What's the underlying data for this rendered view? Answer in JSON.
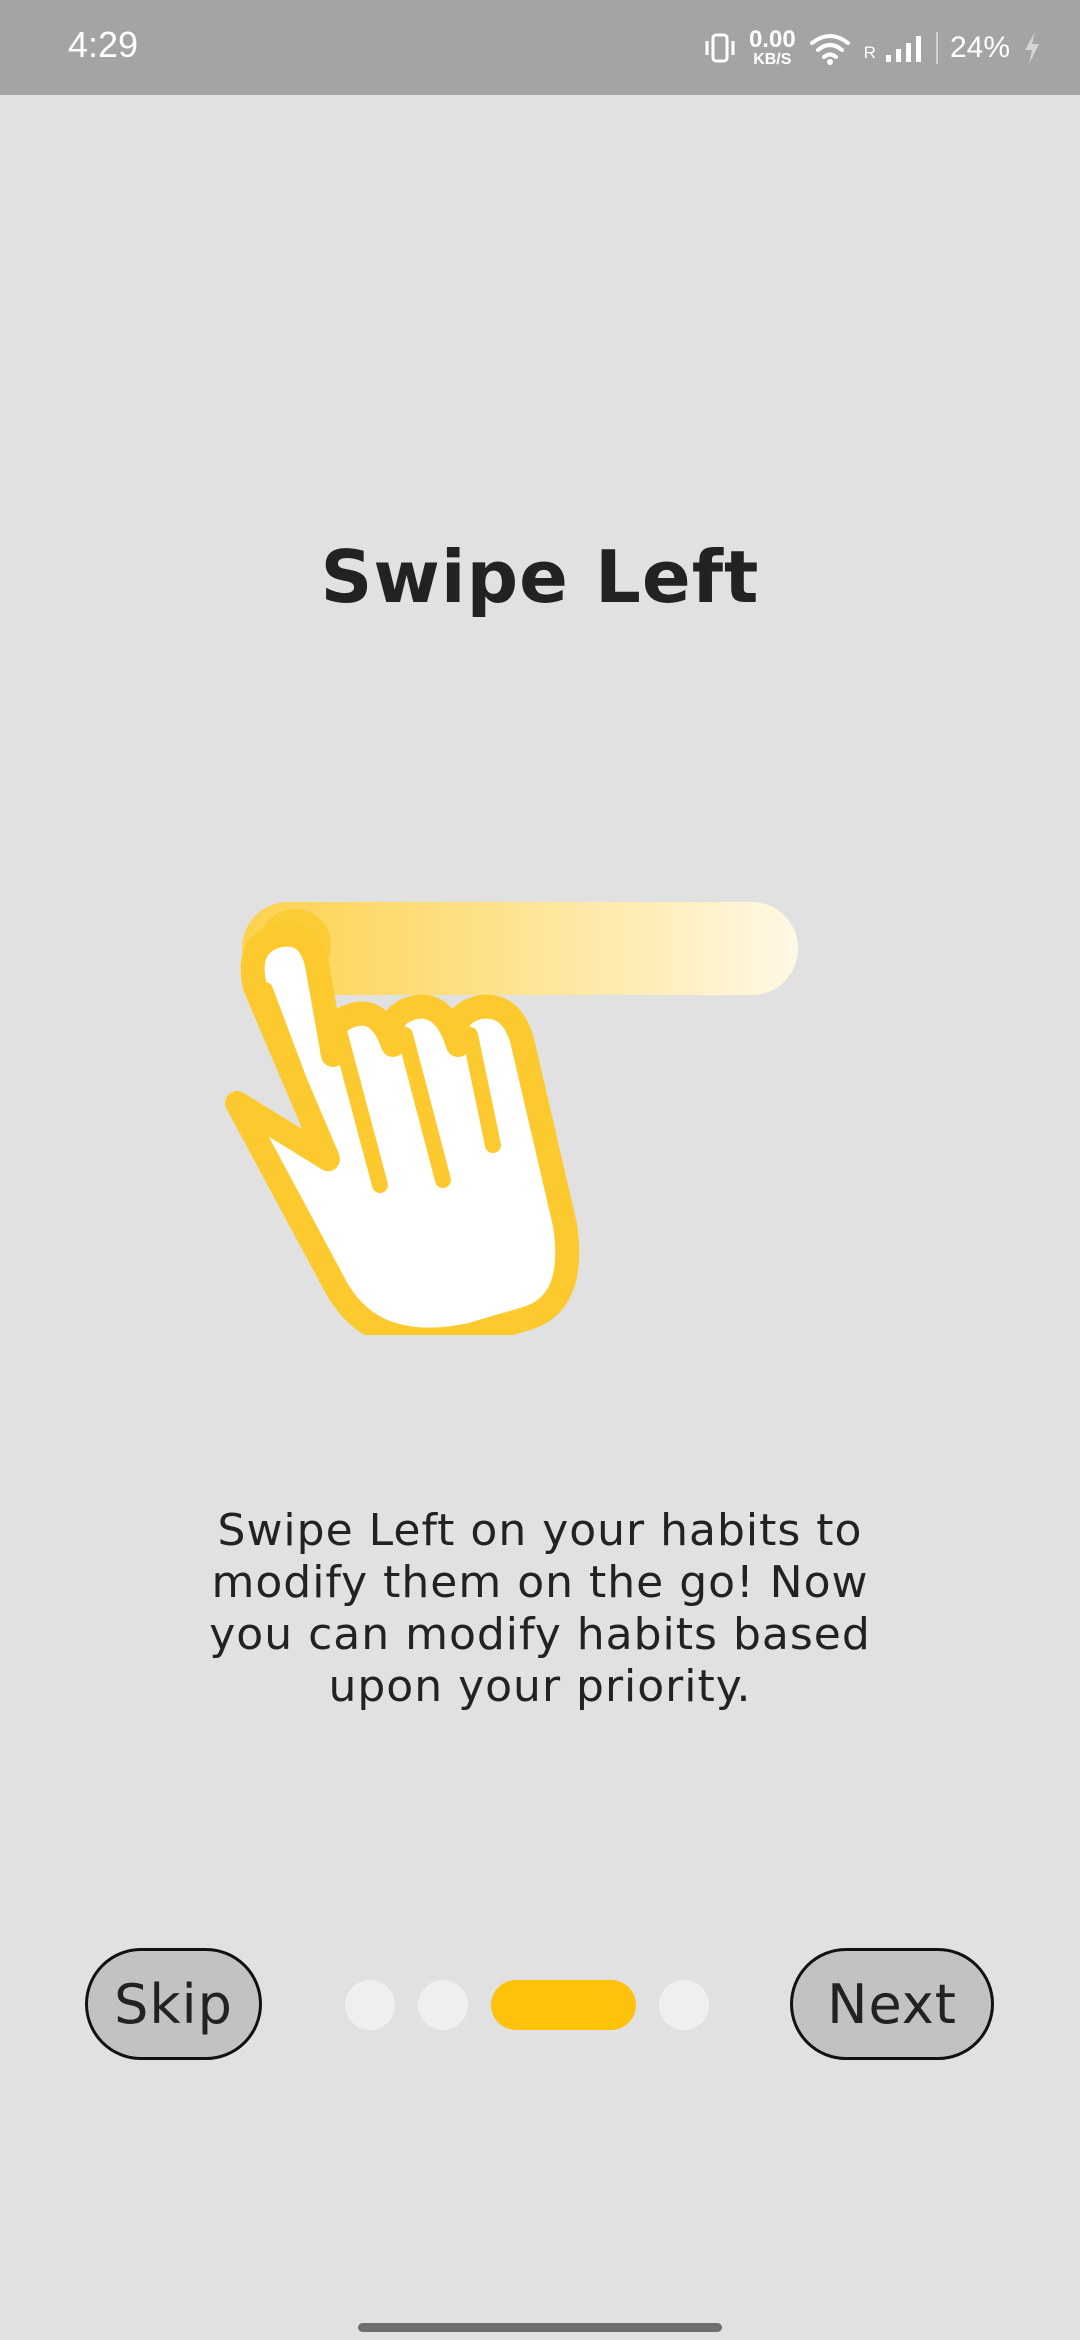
{
  "status_bar": {
    "time": "4:29",
    "net_speed_value": "0.00",
    "net_speed_unit": "KB/S",
    "roaming_label": "R",
    "battery": "24%",
    "icons": [
      "vibrate-icon",
      "wifi-icon",
      "signal-icon",
      "charging-icon"
    ]
  },
  "onboarding": {
    "title": "Swipe Left",
    "description": "Swipe Left on your habits to modify them on the go! Now you can modify habits based upon your priority.",
    "illustration_icon": "swipe-left-hand-icon",
    "accent_color": "#fec20c"
  },
  "navigation": {
    "skip_label": "Skip",
    "next_label": "Next",
    "page_count": 4,
    "current_page": 3
  }
}
